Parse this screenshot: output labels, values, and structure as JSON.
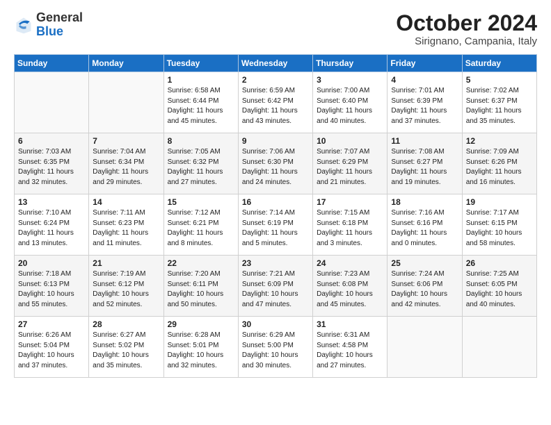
{
  "header": {
    "logo_general": "General",
    "logo_blue": "Blue",
    "month_title": "October 2024",
    "location": "Sirignano, Campania, Italy"
  },
  "days_of_week": [
    "Sunday",
    "Monday",
    "Tuesday",
    "Wednesday",
    "Thursday",
    "Friday",
    "Saturday"
  ],
  "weeks": [
    [
      {
        "day": null
      },
      {
        "day": null
      },
      {
        "day": "1",
        "sunrise": "Sunrise: 6:58 AM",
        "sunset": "Sunset: 6:44 PM",
        "daylight": "Daylight: 11 hours and 45 minutes."
      },
      {
        "day": "2",
        "sunrise": "Sunrise: 6:59 AM",
        "sunset": "Sunset: 6:42 PM",
        "daylight": "Daylight: 11 hours and 43 minutes."
      },
      {
        "day": "3",
        "sunrise": "Sunrise: 7:00 AM",
        "sunset": "Sunset: 6:40 PM",
        "daylight": "Daylight: 11 hours and 40 minutes."
      },
      {
        "day": "4",
        "sunrise": "Sunrise: 7:01 AM",
        "sunset": "Sunset: 6:39 PM",
        "daylight": "Daylight: 11 hours and 37 minutes."
      },
      {
        "day": "5",
        "sunrise": "Sunrise: 7:02 AM",
        "sunset": "Sunset: 6:37 PM",
        "daylight": "Daylight: 11 hours and 35 minutes."
      }
    ],
    [
      {
        "day": "6",
        "sunrise": "Sunrise: 7:03 AM",
        "sunset": "Sunset: 6:35 PM",
        "daylight": "Daylight: 11 hours and 32 minutes."
      },
      {
        "day": "7",
        "sunrise": "Sunrise: 7:04 AM",
        "sunset": "Sunset: 6:34 PM",
        "daylight": "Daylight: 11 hours and 29 minutes."
      },
      {
        "day": "8",
        "sunrise": "Sunrise: 7:05 AM",
        "sunset": "Sunset: 6:32 PM",
        "daylight": "Daylight: 11 hours and 27 minutes."
      },
      {
        "day": "9",
        "sunrise": "Sunrise: 7:06 AM",
        "sunset": "Sunset: 6:30 PM",
        "daylight": "Daylight: 11 hours and 24 minutes."
      },
      {
        "day": "10",
        "sunrise": "Sunrise: 7:07 AM",
        "sunset": "Sunset: 6:29 PM",
        "daylight": "Daylight: 11 hours and 21 minutes."
      },
      {
        "day": "11",
        "sunrise": "Sunrise: 7:08 AM",
        "sunset": "Sunset: 6:27 PM",
        "daylight": "Daylight: 11 hours and 19 minutes."
      },
      {
        "day": "12",
        "sunrise": "Sunrise: 7:09 AM",
        "sunset": "Sunset: 6:26 PM",
        "daylight": "Daylight: 11 hours and 16 minutes."
      }
    ],
    [
      {
        "day": "13",
        "sunrise": "Sunrise: 7:10 AM",
        "sunset": "Sunset: 6:24 PM",
        "daylight": "Daylight: 11 hours and 13 minutes."
      },
      {
        "day": "14",
        "sunrise": "Sunrise: 7:11 AM",
        "sunset": "Sunset: 6:23 PM",
        "daylight": "Daylight: 11 hours and 11 minutes."
      },
      {
        "day": "15",
        "sunrise": "Sunrise: 7:12 AM",
        "sunset": "Sunset: 6:21 PM",
        "daylight": "Daylight: 11 hours and 8 minutes."
      },
      {
        "day": "16",
        "sunrise": "Sunrise: 7:14 AM",
        "sunset": "Sunset: 6:19 PM",
        "daylight": "Daylight: 11 hours and 5 minutes."
      },
      {
        "day": "17",
        "sunrise": "Sunrise: 7:15 AM",
        "sunset": "Sunset: 6:18 PM",
        "daylight": "Daylight: 11 hours and 3 minutes."
      },
      {
        "day": "18",
        "sunrise": "Sunrise: 7:16 AM",
        "sunset": "Sunset: 6:16 PM",
        "daylight": "Daylight: 11 hours and 0 minutes."
      },
      {
        "day": "19",
        "sunrise": "Sunrise: 7:17 AM",
        "sunset": "Sunset: 6:15 PM",
        "daylight": "Daylight: 10 hours and 58 minutes."
      }
    ],
    [
      {
        "day": "20",
        "sunrise": "Sunrise: 7:18 AM",
        "sunset": "Sunset: 6:13 PM",
        "daylight": "Daylight: 10 hours and 55 minutes."
      },
      {
        "day": "21",
        "sunrise": "Sunrise: 7:19 AM",
        "sunset": "Sunset: 6:12 PM",
        "daylight": "Daylight: 10 hours and 52 minutes."
      },
      {
        "day": "22",
        "sunrise": "Sunrise: 7:20 AM",
        "sunset": "Sunset: 6:11 PM",
        "daylight": "Daylight: 10 hours and 50 minutes."
      },
      {
        "day": "23",
        "sunrise": "Sunrise: 7:21 AM",
        "sunset": "Sunset: 6:09 PM",
        "daylight": "Daylight: 10 hours and 47 minutes."
      },
      {
        "day": "24",
        "sunrise": "Sunrise: 7:23 AM",
        "sunset": "Sunset: 6:08 PM",
        "daylight": "Daylight: 10 hours and 45 minutes."
      },
      {
        "day": "25",
        "sunrise": "Sunrise: 7:24 AM",
        "sunset": "Sunset: 6:06 PM",
        "daylight": "Daylight: 10 hours and 42 minutes."
      },
      {
        "day": "26",
        "sunrise": "Sunrise: 7:25 AM",
        "sunset": "Sunset: 6:05 PM",
        "daylight": "Daylight: 10 hours and 40 minutes."
      }
    ],
    [
      {
        "day": "27",
        "sunrise": "Sunrise: 6:26 AM",
        "sunset": "Sunset: 5:04 PM",
        "daylight": "Daylight: 10 hours and 37 minutes."
      },
      {
        "day": "28",
        "sunrise": "Sunrise: 6:27 AM",
        "sunset": "Sunset: 5:02 PM",
        "daylight": "Daylight: 10 hours and 35 minutes."
      },
      {
        "day": "29",
        "sunrise": "Sunrise: 6:28 AM",
        "sunset": "Sunset: 5:01 PM",
        "daylight": "Daylight: 10 hours and 32 minutes."
      },
      {
        "day": "30",
        "sunrise": "Sunrise: 6:29 AM",
        "sunset": "Sunset: 5:00 PM",
        "daylight": "Daylight: 10 hours and 30 minutes."
      },
      {
        "day": "31",
        "sunrise": "Sunrise: 6:31 AM",
        "sunset": "Sunset: 4:58 PM",
        "daylight": "Daylight: 10 hours and 27 minutes."
      },
      {
        "day": null
      },
      {
        "day": null
      }
    ]
  ]
}
